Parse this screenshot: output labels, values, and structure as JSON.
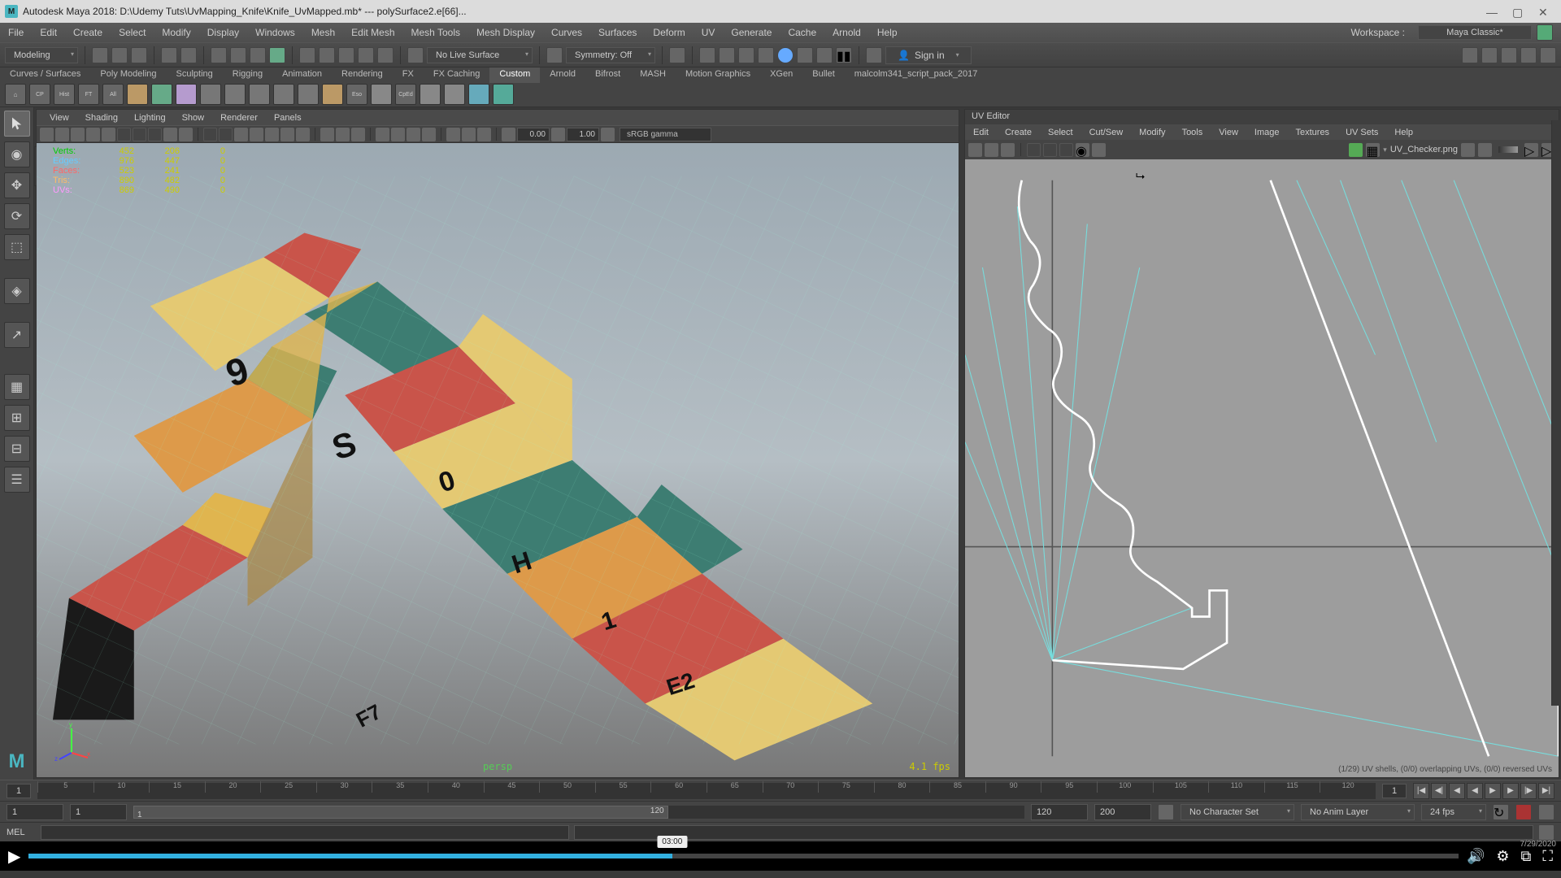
{
  "titlebar": {
    "app_icon": "M",
    "title": "Autodesk Maya 2018: D:\\Udemy Tuts\\UvMapping_Knife\\Knife_UvMapped.mb*  ---  polySurface2.e[66]..."
  },
  "menubar": {
    "items": [
      "File",
      "Edit",
      "Create",
      "Select",
      "Modify",
      "Display",
      "Windows",
      "Mesh",
      "Edit Mesh",
      "Mesh Tools",
      "Mesh Display",
      "Curves",
      "Surfaces",
      "Deform",
      "UV",
      "Generate",
      "Cache",
      "Arnold",
      "Help"
    ],
    "workspace_label": "Workspace :",
    "workspace_value": "Maya Classic*"
  },
  "statusline": {
    "moduledd": "Modeling",
    "live_surface": "No Live Surface",
    "symmetry": "Symmetry: Off",
    "signin": "Sign in"
  },
  "shelf": {
    "tabs": [
      "Curves / Surfaces",
      "Poly Modeling",
      "Sculpting",
      "Rigging",
      "Animation",
      "Rendering",
      "FX",
      "FX Caching",
      "Custom",
      "Arnold",
      "Bifrost",
      "MASH",
      "Motion Graphics",
      "XGen",
      "Bullet",
      "malcolm341_script_pack_2017"
    ],
    "active_tab": 8,
    "icon_labels": [
      "CP",
      "Hist",
      "FT",
      "All",
      "",
      "",
      "",
      "",
      "",
      "",
      "",
      "",
      "",
      "",
      "Eso",
      "CpEd",
      "",
      "",
      "",
      ""
    ]
  },
  "viewport_menu": [
    "View",
    "Shading",
    "Lighting",
    "Show",
    "Renderer",
    "Panels"
  ],
  "viewport_toolbar": {
    "field1": "0.00",
    "field2": "1.00",
    "gamma": "sRGB gamma"
  },
  "hud": {
    "rows": [
      {
        "label": "Verts:",
        "cls": "",
        "v1": "452",
        "v2": "206",
        "v3": "0"
      },
      {
        "label": "Edges:",
        "cls": "e",
        "v1": "976",
        "v2": "447",
        "v3": "0"
      },
      {
        "label": "Faces:",
        "cls": "f",
        "v1": "523",
        "v2": "241",
        "v3": "0"
      },
      {
        "label": "Tris:",
        "cls": "t",
        "v1": "890",
        "v2": "482",
        "v3": "0"
      },
      {
        "label": "UVs:",
        "cls": "u",
        "v1": "869",
        "v2": "490",
        "v3": "0"
      }
    ],
    "fps": "4.1 fps",
    "camera": "persp"
  },
  "uv_panel": {
    "title": "UV Editor",
    "menu": [
      "Edit",
      "Create",
      "Select",
      "Cut/Sew",
      "Modify",
      "Tools",
      "View",
      "Image",
      "Textures",
      "UV Sets",
      "Help"
    ],
    "texture_name": "UV_Checker.png",
    "status": "(1/29) UV shells, (0/0) overlapping UVs, (0/0) reversed UVs"
  },
  "timeline": {
    "ticks": [
      "5",
      "10",
      "15",
      "20",
      "25",
      "30",
      "35",
      "40",
      "45",
      "50",
      "55",
      "60",
      "65",
      "70",
      "75",
      "80",
      "85",
      "90",
      "95",
      "100",
      "105",
      "110",
      "115",
      "120"
    ],
    "current_frame": "1"
  },
  "range": {
    "start_min": "1",
    "start": "1",
    "end": "120",
    "end_max": "200",
    "char_set": "No Character Set",
    "anim_layer": "No Anim Layer",
    "fps": "24 fps"
  },
  "cmdline": {
    "label": "MEL"
  },
  "video": {
    "time_tip": "03:00",
    "date": "7/29/2020"
  }
}
